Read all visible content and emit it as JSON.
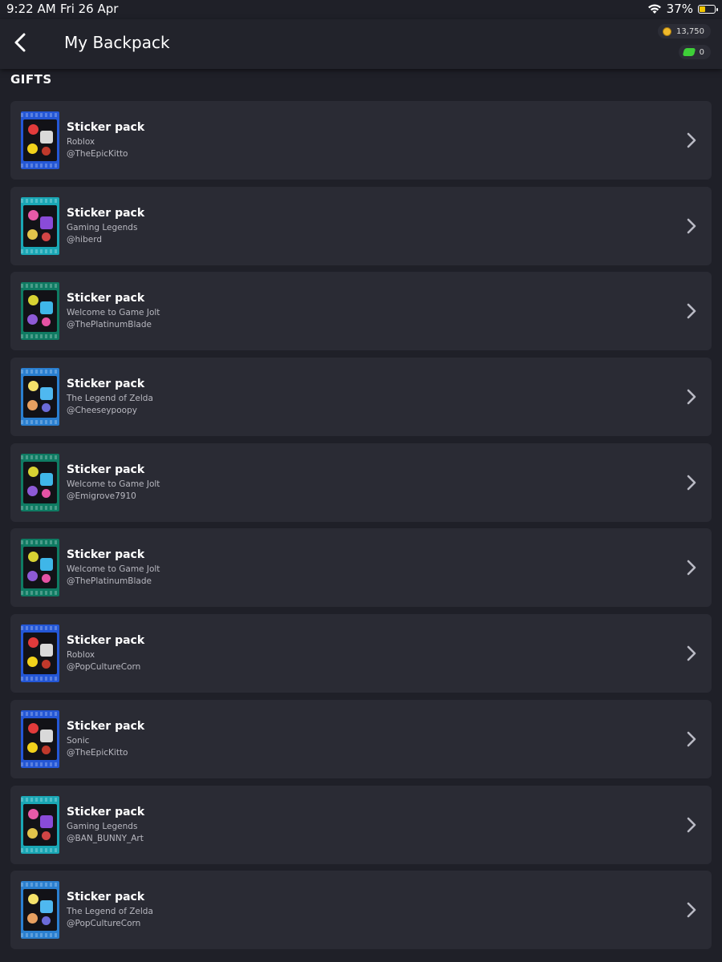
{
  "status": {
    "time": "9:22 AM",
    "date": "Fri 26 Apr",
    "battery": "37%",
    "battery_level": 0.37
  },
  "header": {
    "title": "My Backpack",
    "coins": "13,750",
    "gems": "0"
  },
  "section": {
    "title": "GIFTS"
  },
  "colors": {
    "background": "#1f2028",
    "card": "#2a2b34",
    "pack_blue": "#2457d6",
    "pack_cyan": "#1aa7b5",
    "pack_teal": "#0f7b63",
    "pack_zelda": "#2a7fd0"
  },
  "gifts": [
    {
      "title": "Sticker pack",
      "collection": "Roblox",
      "user": "@TheEpicKitto",
      "pack_theme": "blue"
    },
    {
      "title": "Sticker pack",
      "collection": "Gaming Legends",
      "user": "@hiberd",
      "pack_theme": "cyan"
    },
    {
      "title": "Sticker pack",
      "collection": "Welcome to Game Jolt",
      "user": "@ThePlatinumBlade",
      "pack_theme": "teal"
    },
    {
      "title": "Sticker pack",
      "collection": "The Legend of Zelda",
      "user": "@Cheeseypoopy",
      "pack_theme": "zelda"
    },
    {
      "title": "Sticker pack",
      "collection": "Welcome to Game Jolt",
      "user": "@Emigrove7910",
      "pack_theme": "teal"
    },
    {
      "title": "Sticker pack",
      "collection": "Welcome to Game Jolt",
      "user": "@ThePlatinumBlade",
      "pack_theme": "teal"
    },
    {
      "title": "Sticker pack",
      "collection": "Roblox",
      "user": "@PopCultureCorn",
      "pack_theme": "blue"
    },
    {
      "title": "Sticker pack",
      "collection": "Sonic",
      "user": "@TheEpicKitto",
      "pack_theme": "blue"
    },
    {
      "title": "Sticker pack",
      "collection": "Gaming Legends",
      "user": "@BAN_BUNNY_Art",
      "pack_theme": "cyan"
    },
    {
      "title": "Sticker pack",
      "collection": "The Legend of Zelda",
      "user": "@PopCultureCorn",
      "pack_theme": "zelda"
    }
  ]
}
